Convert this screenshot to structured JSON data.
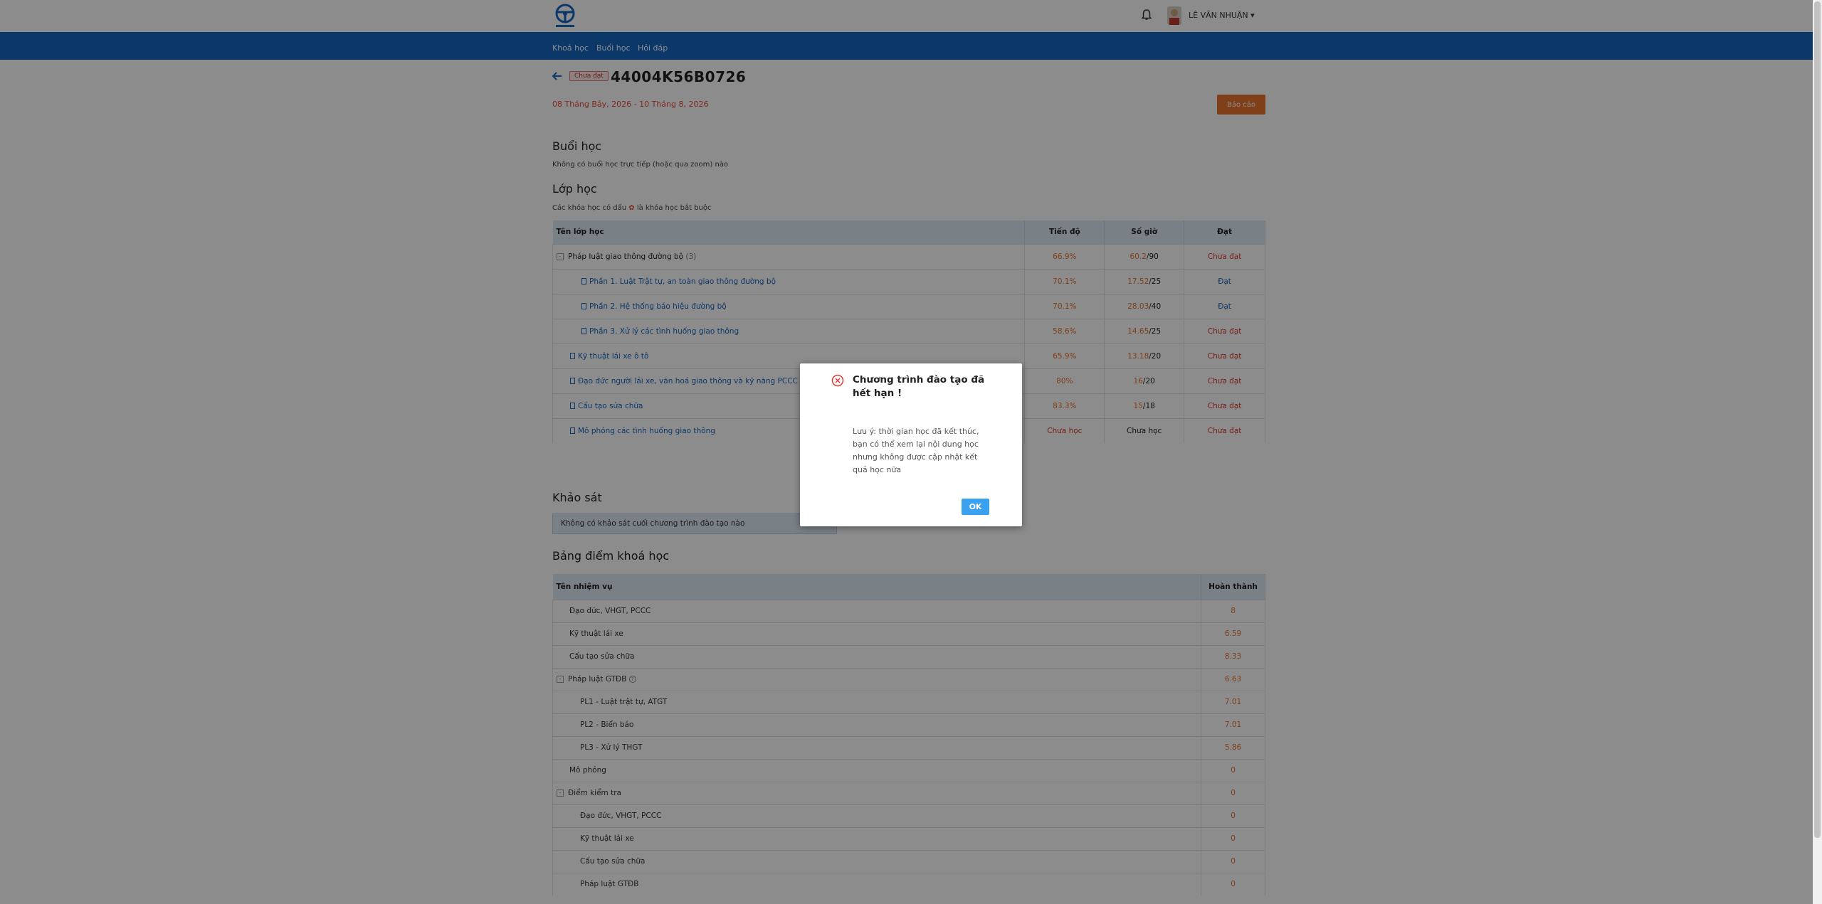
{
  "header": {
    "user_name": "LÊ VĂN NHUẬN",
    "logo_icon": "steering-wheel-logo",
    "bell_icon": "bell-icon"
  },
  "nav": {
    "items": [
      {
        "label": "Khoá học"
      },
      {
        "label": "Buổi học"
      },
      {
        "label": "Hỏi đáp"
      }
    ]
  },
  "course": {
    "status_badge": "Chưa đạt",
    "code": "44004K56B0726",
    "date_range": "08 Tháng Bảy, 2026 - 10 Tháng 8, 2026",
    "report_label": "Báo cáo"
  },
  "sessions": {
    "title": "Buổi học",
    "note": "Không có buổi học trực tiếp (hoặc qua zoom) nào"
  },
  "classes": {
    "title": "Lớp học",
    "note_prefix": "Các khóa học có dấu",
    "note_suffix": "là khóa học bắt buộc",
    "headers": [
      "Tên lớp học",
      "Tiến độ",
      "Số giờ",
      "Đạt"
    ],
    "rows": [
      {
        "name": "Pháp luật giao thông đường bộ",
        "count": "(3)",
        "progress": "66.9%",
        "hours_done": "60.2",
        "hours_total": "/90",
        "result": "Chưa đạt"
      },
      {
        "name": "Phần 1. Luật Trật tự, an toàn giao thông đường bộ",
        "progress": "70.1%",
        "hours_done": "17.52",
        "hours_total": "/25",
        "result": "Đạt"
      },
      {
        "name": "Phần 2. Hệ thống báo hiệu đường bộ",
        "progress": "70.1%",
        "hours_done": "28.03",
        "hours_total": "/40",
        "result": "Đạt"
      },
      {
        "name": "Phần 3. Xử lý các tình huống giao thông",
        "progress": "58.6%",
        "hours_done": "14.65",
        "hours_total": "/25",
        "result": "Chưa đạt"
      },
      {
        "name": "Kỹ thuật lái xe ô tô",
        "progress": "65.9%",
        "hours_done": "13.18",
        "hours_total": "/20",
        "result": "Chưa đạt"
      },
      {
        "name": "Đạo đức người lái xe, văn hoá giao thông và kỹ năng PCCC và c",
        "progress": "80%",
        "hours_done": "16",
        "hours_total": "/20",
        "result": "Chưa đạt"
      },
      {
        "name": "Cấu tạo sửa chữa",
        "progress": "83.3%",
        "hours_done": "15",
        "hours_total": "/18",
        "result": "Chưa đạt"
      },
      {
        "name": "Mô phỏng các tình huống giao thông",
        "progress": "Chưa học",
        "hours_done": "",
        "hours_total": "Chưa học",
        "result": "Chưa đạt"
      }
    ]
  },
  "survey": {
    "title": "Khảo sát",
    "message": "Không có khảo sát cuối chương trình đào tạo nào"
  },
  "grades": {
    "title": "Bảng điểm khoá học",
    "headers": [
      "Tên nhiệm vụ",
      "Hoàn thành"
    ],
    "rows": [
      {
        "name": "Đạo đức, VHGT, PCCC",
        "score": "8"
      },
      {
        "name": "Kỹ thuật lái xe",
        "score": "6.59"
      },
      {
        "name": "Cấu tạo sửa chữa",
        "score": "8.33"
      },
      {
        "name": "Pháp luật GTĐB",
        "score": "6.63"
      },
      {
        "name": "PL1 - Luật trật tự, ATGT",
        "score": "7.01"
      },
      {
        "name": "PL2 - Biển báo",
        "score": "7.01"
      },
      {
        "name": "PL3 - Xử lý THGT",
        "score": "5.86"
      },
      {
        "name": "Mô phỏng",
        "score": "0"
      },
      {
        "name": "Điểm kiểm tra",
        "score": "0"
      },
      {
        "name": "Đạo đức, VHGT, PCCC",
        "score": "0"
      },
      {
        "name": "Kỹ thuật lái xe",
        "score": "0"
      },
      {
        "name": "Cấu tạo sửa chữa",
        "score": "0"
      },
      {
        "name": "Pháp luật GTĐB",
        "score": "0"
      }
    ]
  },
  "modal": {
    "title": "Chương trình đào tạo đã hết hạn !",
    "body": "Lưu ý: thời gian học đã kết thúc, bạn có thể xem lại nội dung học nhưng không được cập nhật kết quả học nữa",
    "ok_label": "OK",
    "icon": "error-circle-icon"
  },
  "colors": {
    "primary": "#1565c0",
    "accent_orange": "#e8732c",
    "fail_red": "#d9342b",
    "ok_button": "#3aa0f0"
  }
}
